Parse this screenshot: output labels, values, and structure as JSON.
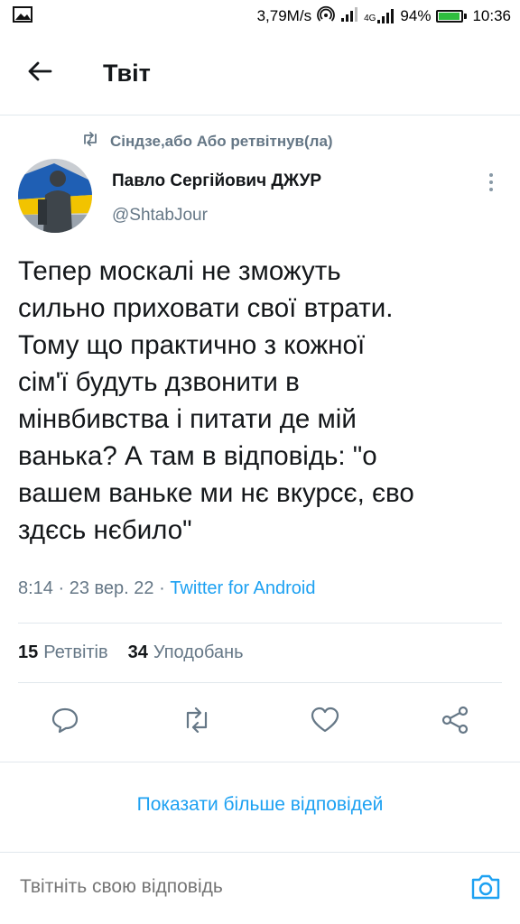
{
  "status_bar": {
    "network_speed": "3,79M/s",
    "network_type": "4G",
    "battery_percent": "94%",
    "battery_level": 0.94,
    "time": "10:36",
    "icons": [
      "image-icon",
      "hotspot-icon",
      "signal-icon",
      "signal-4g-icon",
      "battery-icon"
    ]
  },
  "header": {
    "title": "Твіт",
    "back_icon": "arrow-left-icon"
  },
  "retweet_context": {
    "icon": "retweet-icon",
    "text": "Сіндзе,або Або ретвітнув(ла)"
  },
  "tweet": {
    "author_name": "Павло Сергійович ДЖУР",
    "author_handle": "@ShtabJour",
    "text": "Тепер москалі не зможуть\nсильно приховати свої втрати.\nТому що практично з кожної\nсім'ї будуть дзвонити в\nмінвбивства і питати де мій\nванька? А там в відповідь: \"о\nвашем ваньке ми нє вкурсє, єво\nздєсь нєбило\"",
    "time": "8:14",
    "date": "23 вер. 22",
    "separator": " · ",
    "source": "Twitter for Android"
  },
  "stats": {
    "retweets_count": "15",
    "retweets_label": "Ретвітів",
    "likes_count": "34",
    "likes_label": "Уподобань"
  },
  "actions": [
    "reply-icon",
    "retweet-icon",
    "like-icon",
    "share-icon"
  ],
  "show_more_replies": "Показати більше відповідей",
  "reply_bar": {
    "placeholder": "Твітніть свою відповідь",
    "camera_icon": "camera-icon"
  },
  "colors": {
    "accent": "#1da1f2",
    "secondary_text": "#657786",
    "primary_text": "#14171a",
    "divider": "#e1e8ed",
    "battery_fill": "#2fbd3f"
  }
}
